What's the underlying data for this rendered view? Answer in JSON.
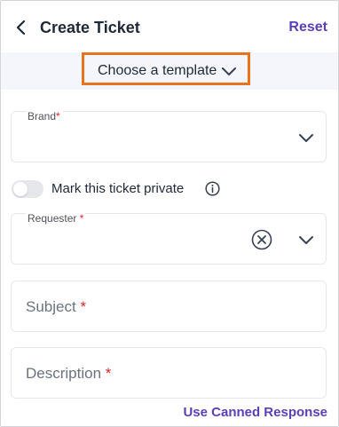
{
  "header": {
    "title": "Create Ticket",
    "reset_label": "Reset"
  },
  "template": {
    "label": "Choose a template",
    "highlight_color": "#e8731c"
  },
  "form": {
    "brand": {
      "label": "Brand",
      "required_mark": "*"
    },
    "private_toggle": {
      "label": "Mark this ticket private",
      "checked": false
    },
    "requester": {
      "label": "Requester",
      "required_mark": "*"
    },
    "subject": {
      "placeholder": "Subject",
      "required_mark": "*"
    },
    "description": {
      "placeholder": "Description",
      "required_mark": "*"
    }
  },
  "footer": {
    "canned_response_label": "Use Canned Response"
  },
  "colors": {
    "accent": "#5b3fb8",
    "required": "#dc2626",
    "template_bar_bg": "#f4f6fb"
  },
  "icons": {
    "back": "chevron-left-icon",
    "dropdown": "chevron-down-icon",
    "info": "info-icon",
    "clear": "clear-circle-icon"
  }
}
